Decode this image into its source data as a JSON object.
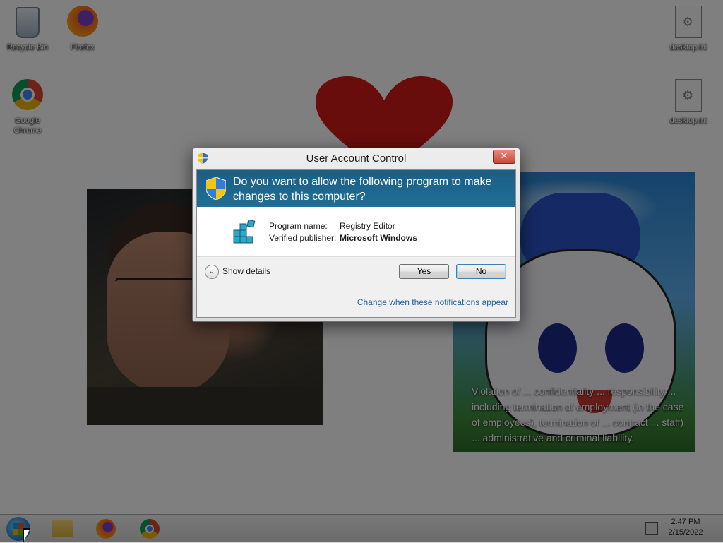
{
  "desktop": {
    "icons": [
      {
        "label": "Recycle Bin",
        "icon": "recycle-bin-icon"
      },
      {
        "label": "Firefox",
        "icon": "firefox-icon"
      },
      {
        "label": "Google Chrome",
        "icon": "chrome-icon"
      },
      {
        "label": "desktop.ini",
        "icon": "ini-file-icon"
      },
      {
        "label": "desktop.ini",
        "icon": "ini-file-icon"
      }
    ],
    "wallpaper_text": "Violation of ... confidentiality ... responsibility ... including termination of employment (in the case of employees), termination of ... contract ... staff) ... administrative and criminal liability."
  },
  "taskbar": {
    "items": [
      "start-button",
      "file-explorer",
      "firefox",
      "chrome"
    ],
    "clock_time": "2:47 PM",
    "clock_date": "2/15/2022"
  },
  "uac": {
    "title": "User Account Control",
    "close_glyph": "✕",
    "question": "Do you want to allow the following program to make changes to this computer?",
    "program_label": "Program name:",
    "program_value": "Registry Editor",
    "publisher_label": "Verified publisher:",
    "publisher_value": "Microsoft Windows",
    "details_prefix": "Show ",
    "details_underlined": "d",
    "details_suffix": "etails",
    "yes_label": "Yes",
    "no_label": "No",
    "change_link": "Change when these notifications appear",
    "colors": {
      "banner": "#1f6e97",
      "link": "#1f5f9f"
    }
  }
}
